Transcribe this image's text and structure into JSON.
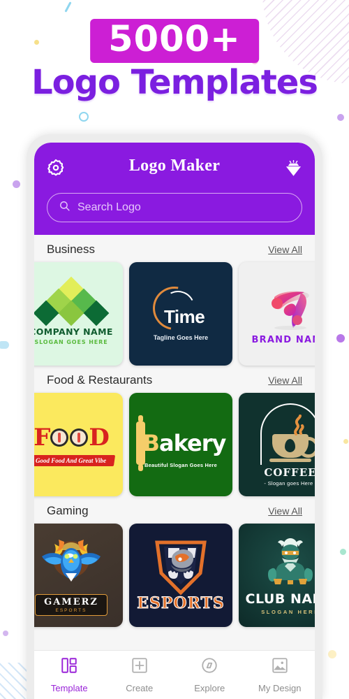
{
  "hero": {
    "badge": "5000+",
    "title": "Logo Templates",
    "badge_color": "#cc1fd4",
    "title_color": "#7b1fe0"
  },
  "app": {
    "title": "Logo Maker",
    "header_color": "#8a1ae0",
    "settings_icon": "gear-icon",
    "premium_icon": "diamond-icon",
    "search": {
      "icon": "search-icon",
      "placeholder": "Search Logo",
      "value": ""
    }
  },
  "sections": [
    {
      "title": "Business",
      "view_all": "View All",
      "cards": [
        {
          "id": "company-name",
          "name": "COMPANY NAME",
          "slogan": "SLOGAN GOES HERE",
          "background": "#ddf7e3"
        },
        {
          "id": "time",
          "name": "Time",
          "slogan": "Tagline Goes Here",
          "background": "#102a43"
        },
        {
          "id": "brand-name",
          "name": "BRAND NAME",
          "slogan": "",
          "background": "#f0f0f0"
        }
      ]
    },
    {
      "title": "Food & Restaurants",
      "view_all": "View All",
      "cards": [
        {
          "id": "food",
          "name": "FOOD",
          "slogan": "Good Food And Great Vibe",
          "background": "#fbe95e"
        },
        {
          "id": "bakery",
          "name": "Bakery",
          "slogan": "Beautiful Slogan Goes Here",
          "background": "#136b12"
        },
        {
          "id": "coffee",
          "name": "COFFEE",
          "slogan": "- Slogan goes Here -",
          "background": "#10322e"
        }
      ]
    },
    {
      "title": "Gaming",
      "view_all": "View All",
      "cards": [
        {
          "id": "gamerz",
          "name": "GAMERZ",
          "slogan": "ESPORTS",
          "background": "#4a3d32"
        },
        {
          "id": "esports",
          "name": "ESPORTS",
          "slogan": "",
          "background": "#121a35"
        },
        {
          "id": "club-name",
          "name": "CLUB NAME",
          "slogan": "SLOGAN HERE",
          "background": "#11403a"
        }
      ]
    }
  ],
  "bottom_nav": {
    "active_color": "#9a25d8",
    "items": [
      {
        "label": "Template",
        "icon": "grid-layout-icon",
        "active": true
      },
      {
        "label": "Create",
        "icon": "plus-square-icon",
        "active": false
      },
      {
        "label": "Explore",
        "icon": "compass-icon",
        "active": false
      },
      {
        "label": "My Design",
        "icon": "image-icon",
        "active": false
      }
    ]
  },
  "letters": {
    "time_T": "T",
    "time_rest": "ime",
    "bakery_B": "B",
    "bakery_rest": "akery",
    "food_F": "F",
    "food_D": "D"
  }
}
